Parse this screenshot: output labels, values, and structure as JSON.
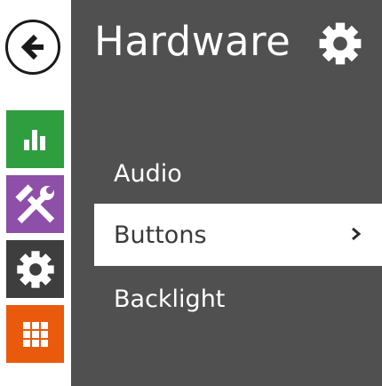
{
  "nav": {
    "back_icon": "arrow-left-icon",
    "items": [
      {
        "id": "status",
        "icon": "bar-chart-icon",
        "color": "#2e9e3f"
      },
      {
        "id": "services",
        "icon": "tools-icon",
        "color": "#8d4fa8"
      },
      {
        "id": "hardware",
        "icon": "gear-icon",
        "color": "#3e3e3e"
      },
      {
        "id": "apps",
        "icon": "grid-icon",
        "color": "#ea5a0c"
      }
    ]
  },
  "panel": {
    "title": "Hardware",
    "title_icon": "gear-icon",
    "background": "#505050",
    "menu": [
      {
        "label": "Audio",
        "selected": false
      },
      {
        "label": "Buttons",
        "selected": true
      },
      {
        "label": "Backlight",
        "selected": false
      }
    ]
  }
}
